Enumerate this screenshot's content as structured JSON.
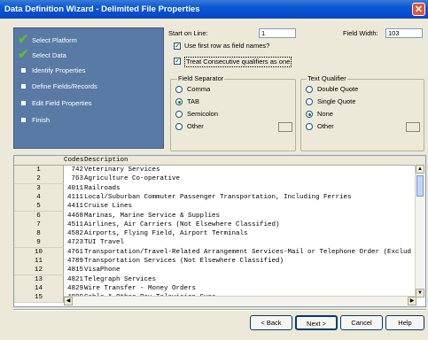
{
  "window": {
    "title": "Data Definition Wizard - Delimited File Properties",
    "close_glyph": "✕"
  },
  "steps": [
    {
      "label": "Select Platform",
      "done": true
    },
    {
      "label": "Select Data",
      "done": true
    },
    {
      "label": "Identify Properties",
      "done": false
    },
    {
      "label": "Define Fields/Records",
      "done": false
    },
    {
      "label": "Edit Field Properties",
      "done": false
    },
    {
      "label": "Finish",
      "done": false
    }
  ],
  "options": {
    "start_on_line_label": "Start on Line:",
    "start_on_line_value": "1",
    "field_width_label": "Field Width:",
    "field_width_value": "103",
    "first_row_names_label": "Use first row as field names?",
    "first_row_names_checked": true,
    "consecutive_qualifiers_label": "Treat Consecutive qualifiers as one",
    "consecutive_qualifiers_checked": true
  },
  "field_separator": {
    "title": "Field Separator",
    "options": [
      "Comma",
      "TAB",
      "Semicolon",
      "Other"
    ],
    "selected": "TAB"
  },
  "text_qualifier": {
    "title": "Text Qualifier",
    "options": [
      "Double Quote",
      "Single Quote",
      "None",
      "Other"
    ],
    "selected": "None"
  },
  "grid": {
    "headers": {
      "codes": "Codes",
      "description": "Description"
    },
    "rows": [
      {
        "n": "1",
        "code": "742",
        "desc": "Veterinary Services"
      },
      {
        "n": "2",
        "code": "763",
        "desc": "Agriculture Co-operative"
      },
      {
        "n": "3",
        "code": "4011",
        "desc": "Railroads"
      },
      {
        "n": "4",
        "code": "4111",
        "desc": "Local/Suburban Commuter Passenger Transportation, Including Ferries"
      },
      {
        "n": "5",
        "code": "4411",
        "desc": "Cruise Lines"
      },
      {
        "n": "6",
        "code": "4468",
        "desc": "Marinas, Marine Service & Supplies"
      },
      {
        "n": "7",
        "code": "4511",
        "desc": "Airlines, Air Carriers (Not Elsewhere Classified)"
      },
      {
        "n": "8",
        "code": "4582",
        "desc": "Airports, Flying Field, Airport Terminals"
      },
      {
        "n": "9",
        "code": "4723",
        "desc": "TUI Travel"
      },
      {
        "n": "10",
        "code": "4761",
        "desc": "Transportation/Travel-Related Arrangement Services-Mail or Telephone Order (Exclud"
      },
      {
        "n": "11",
        "code": "4789",
        "desc": "Transportation Services (Not Elsewhere Classified)"
      },
      {
        "n": "12",
        "code": "4815",
        "desc": "VisaPhone"
      },
      {
        "n": "13",
        "code": "4821",
        "desc": "Telegraph Services"
      },
      {
        "n": "14",
        "code": "4829",
        "desc": "Wire Transfer - Money Orders"
      },
      {
        "n": "15",
        "code": "4899",
        "desc": "Cable & Other Pay Television Svcs."
      }
    ]
  },
  "buttons": {
    "back": "< Back",
    "next": "Next >",
    "cancel": "Cancel",
    "help": "Help"
  }
}
